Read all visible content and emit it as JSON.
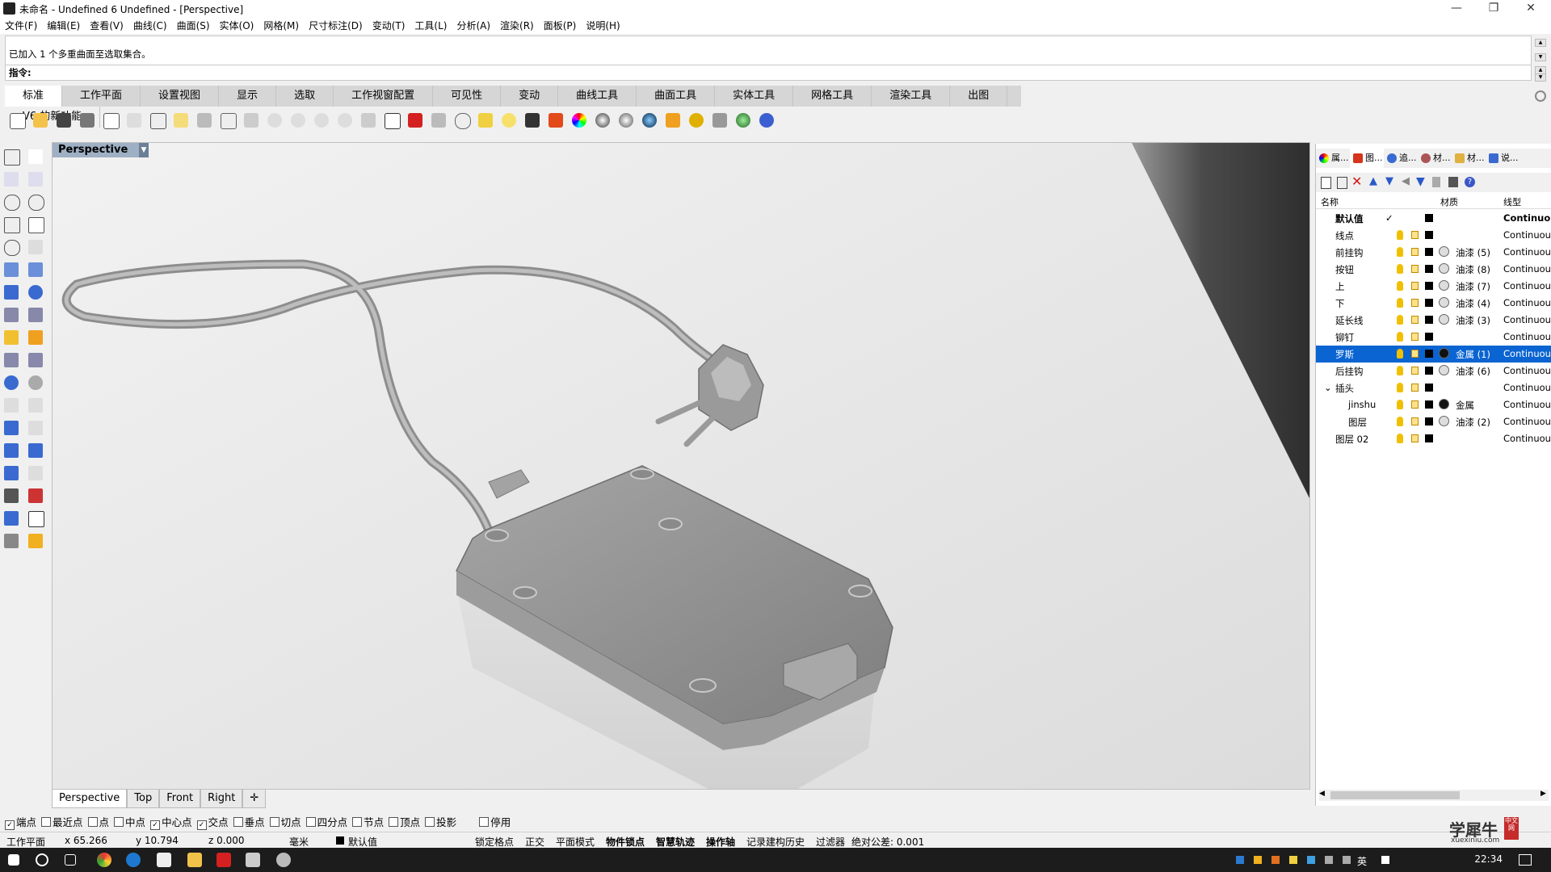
{
  "window": {
    "title": "未命名 - Undefined 6 Undefined - [Perspective]",
    "minimize": "—",
    "maximize": "❐",
    "close": "✕"
  },
  "menu": [
    "文件(F)",
    "编辑(E)",
    "查看(V)",
    "曲线(C)",
    "曲面(S)",
    "实体(O)",
    "网格(M)",
    "尺寸标注(D)",
    "变动(T)",
    "工具(L)",
    "分析(A)",
    "渲染(R)",
    "面板(P)",
    "说明(H)"
  ],
  "command": {
    "history": "已加入 1 个多重曲面至选取集合。",
    "prompt": "指令:"
  },
  "tabs": [
    "标准",
    "工作平面",
    "设置视图",
    "显示",
    "选取",
    "工作视窗配置",
    "可见性",
    "变动",
    "曲线工具",
    "曲面工具",
    "实体工具",
    "网格工具",
    "渲染工具",
    "出图",
    "V6 的新功能"
  ],
  "toolbar_icons": [
    "new-icon",
    "open-icon",
    "save-icon",
    "print-icon",
    "import-icon",
    "cut-icon",
    "copy-icon",
    "paste-icon",
    "undo-icon",
    "pan-icon",
    "rotate-icon",
    "zoom-window-icon",
    "zoom-extents-icon",
    "zoom-all-icon",
    "zoom-selected-icon",
    "rotate-view-icon",
    "four-view-icon",
    "car-icon",
    "toggle-icon",
    "circle-icon",
    "points-icon",
    "light-icon",
    "lock-icon",
    "shield-icon",
    "color-wheel-icon",
    "shade-icon",
    "sphere-icon",
    "render-icon",
    "filter-icon",
    "gear-icon",
    "dimension-icon",
    "globe-icon",
    "help-icon"
  ],
  "viewport": {
    "label": "Perspective",
    "tabs": [
      "Perspective",
      "Top",
      "Front",
      "Right"
    ],
    "add_tab": "✛"
  },
  "panel": {
    "tabs": [
      "属...",
      "图...",
      "追...",
      "材...",
      "材...",
      "说..."
    ],
    "headers": {
      "name": "名称",
      "material": "材质",
      "linetype": "线型"
    },
    "layers": [
      {
        "name": "默认值",
        "check": "✓",
        "material": "",
        "linetype": "Continuous",
        "bold": true
      },
      {
        "name": "线点",
        "material": "",
        "linetype": "Continuous"
      },
      {
        "name": "前挂钩",
        "material": "油漆 (5)",
        "linetype": "Continuous"
      },
      {
        "name": "按钮",
        "material": "油漆 (8)",
        "linetype": "Continuous"
      },
      {
        "name": "上",
        "material": "油漆 (7)",
        "linetype": "Continuous"
      },
      {
        "name": "下",
        "material": "油漆 (4)",
        "linetype": "Continuous"
      },
      {
        "name": "延长线",
        "material": "油漆 (3)",
        "linetype": "Continuous"
      },
      {
        "name": "铆钉",
        "material": "",
        "linetype": "Continuous"
      },
      {
        "name": "罗斯",
        "material": "金属 (1)",
        "linetype": "Continuous",
        "selected": true
      },
      {
        "name": "后挂钩",
        "material": "油漆 (6)",
        "linetype": "Continuous"
      },
      {
        "name": "插头",
        "material": "",
        "linetype": "Continuous",
        "expanded": true
      },
      {
        "name": "jinshu",
        "material": "金属",
        "linetype": "Continuous",
        "child": true
      },
      {
        "name": "图层",
        "material": "油漆 (2)",
        "linetype": "Continuous",
        "child": true
      },
      {
        "name": "图层 02",
        "material": "",
        "linetype": "Continuous"
      }
    ]
  },
  "osnaps": [
    {
      "label": "端点",
      "checked": true
    },
    {
      "label": "最近点",
      "checked": false
    },
    {
      "label": "点",
      "checked": false
    },
    {
      "label": "中点",
      "checked": false
    },
    {
      "label": "中心点",
      "checked": true
    },
    {
      "label": "交点",
      "checked": true
    },
    {
      "label": "垂点",
      "checked": false
    },
    {
      "label": "切点",
      "checked": false
    },
    {
      "label": "四分点",
      "checked": false
    },
    {
      "label": "节点",
      "checked": false
    },
    {
      "label": "顶点",
      "checked": false
    },
    {
      "label": "投影",
      "checked": false
    },
    {
      "label": "停用",
      "checked": false
    }
  ],
  "status": {
    "cplane": "工作平面",
    "x": "x 65.266",
    "y": "y 10.794",
    "z": "z 0.000",
    "unit": "毫米",
    "layer": "默认值",
    "grid_snap": "锁定格点",
    "ortho": "正交",
    "planar": "平面模式",
    "osnap": "物件锁点",
    "smarttrack": "智慧轨迹",
    "gumball": "操作轴",
    "history": "记录建构历史",
    "filter": "过滤器",
    "tolerance": "绝对公差: 0.001"
  },
  "taskbar": {
    "time": "22:34",
    "ime": "英"
  },
  "watermark": {
    "text": "学犀牛",
    "url": "xuexiniu.com",
    "seal": "中文网"
  },
  "colors": {
    "accent": "#0a64d2",
    "viewport_label": "#9fb0c4"
  }
}
